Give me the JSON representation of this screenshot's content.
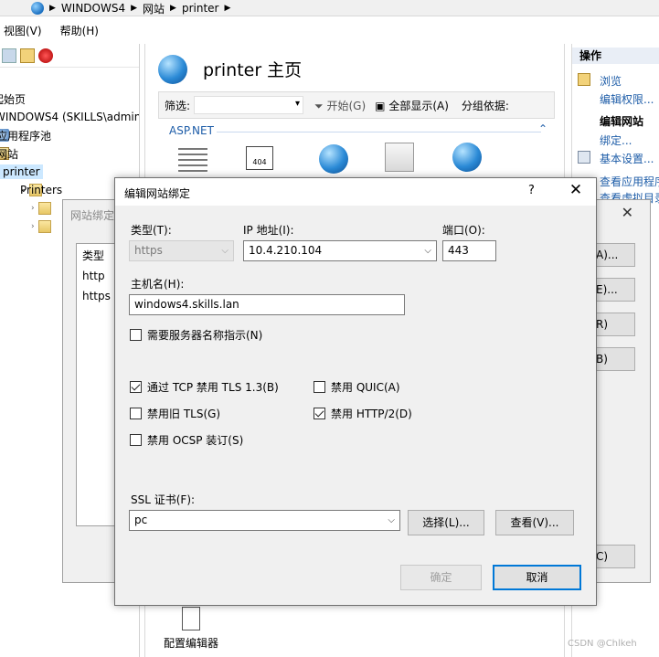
{
  "address": {
    "crumbs": [
      "WINDOWS4",
      "网站",
      "printer"
    ]
  },
  "menu": {
    "items": [
      "视图(V)",
      "帮助(H)"
    ]
  },
  "tree": {
    "items": [
      "起始页",
      "WINDOWS4 (SKILLS\\admin",
      "应用程序池",
      "网站",
      "printer",
      "Printers"
    ]
  },
  "center": {
    "title": "printer 主页",
    "filter_label": "筛选:",
    "start_label": "开始(G)",
    "show_all_label": "全部显示(A)",
    "group_label": "分组依据:",
    "section": "ASP.NET",
    "feature_404": "404",
    "editor_label": "配置编辑器"
  },
  "actions": {
    "header": "操作",
    "browse": "浏览",
    "edit_perms": "编辑权限...",
    "edit_site": "编辑网站",
    "bindings": "绑定...",
    "basic_settings": "基本设置...",
    "view_apps": "查看应用程序",
    "view_vdirs": "查看虚拟目录"
  },
  "bindings_dialog": {
    "title": "网站绑定",
    "close": "✕",
    "col_type": "类型",
    "rows": [
      "http",
      "https"
    ],
    "btn_add": "A)...",
    "btn_edit": "E)...",
    "btn_remove": "R)",
    "btn_browse": "B)",
    "btn_close": "C)"
  },
  "dialog": {
    "title": "编辑网站绑定",
    "help": "?",
    "close": "✕",
    "type_label": "类型(T):",
    "type_value": "https",
    "ip_label": "IP 地址(I):",
    "ip_value": "10.4.210.104",
    "port_label": "端口(O):",
    "port_value": "443",
    "host_label": "主机名(H):",
    "host_value": "windows4.skills.lan",
    "sni_label": "需要服务器名称指示(N)",
    "tls13_label": "通过 TCP 禁用 TLS 1.3(B)",
    "quic_label": "禁用 QUIC(A)",
    "legacy_tls_label": "禁用旧 TLS(G)",
    "http2_label": "禁用 HTTP/2(D)",
    "ocsp_label": "禁用 OCSP 装订(S)",
    "ssl_label": "SSL 证书(F):",
    "ssl_value": "pc",
    "select_btn": "选择(L)...",
    "view_btn": "查看(V)...",
    "ok_btn": "确定",
    "cancel_btn": "取消"
  },
  "checkboxes": {
    "sni": false,
    "tls13": true,
    "quic": false,
    "legacy_tls": false,
    "http2": true,
    "ocsp": false
  },
  "watermark": "CSDN @Chlkeh"
}
